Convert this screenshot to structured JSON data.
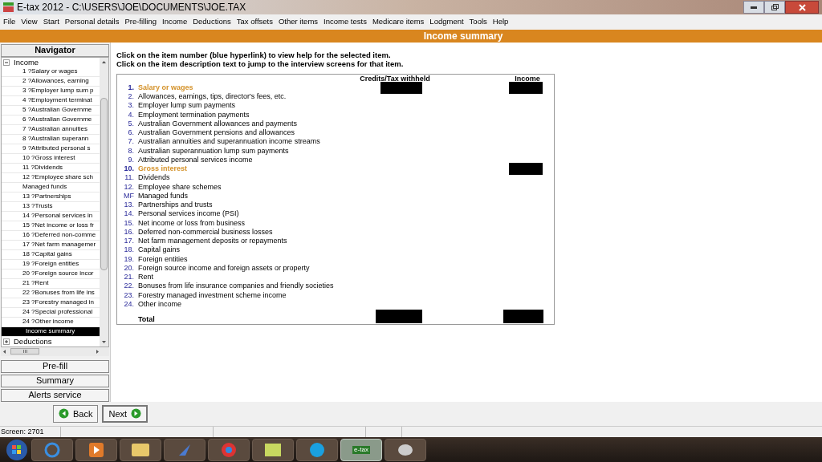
{
  "window": {
    "title": "E-tax 2012 - C:\\USERS\\JOE\\DOCUMENTS\\JOE.TAX"
  },
  "menu": [
    "File",
    "View",
    "Start",
    "Personal details",
    "Pre-filling",
    "Income",
    "Deductions",
    "Tax offsets",
    "Other items",
    "Income tests",
    "Medicare items",
    "Lodgment",
    "Tools",
    "Help"
  ],
  "page_title": "Income summary",
  "navigator": {
    "title": "Navigator",
    "groups": [
      {
        "label": "Income",
        "expanded": true,
        "children": [
          {
            "label": "1 ?Salary or wages",
            "selected": false
          },
          {
            "label": "2 ?Allowances, earning",
            "selected": false
          },
          {
            "label": "3 ?Employer lump sum p",
            "selected": false
          },
          {
            "label": "4 ?Employment terminat",
            "selected": false
          },
          {
            "label": "5 ?Australian Governme",
            "selected": false
          },
          {
            "label": "6 ?Australian Governme",
            "selected": false
          },
          {
            "label": "7 ?Australian annuities",
            "selected": false
          },
          {
            "label": "8 ?Australian superann",
            "selected": false
          },
          {
            "label": "9 ?Attributed personal s",
            "selected": false
          },
          {
            "label": "10 ?Gross interest",
            "selected": false
          },
          {
            "label": "11 ?Dividends",
            "selected": false
          },
          {
            "label": "12 ?Employee share sch",
            "selected": false
          },
          {
            "label": "Managed funds",
            "selected": false
          },
          {
            "label": "13 ?Partnerships",
            "selected": false
          },
          {
            "label": "13 ?Trusts",
            "selected": false
          },
          {
            "label": "14 ?Personal services in",
            "selected": false
          },
          {
            "label": "15 ?Net income or loss fr",
            "selected": false
          },
          {
            "label": "16 ?Deferred non-comme",
            "selected": false
          },
          {
            "label": "17 ?Net farm managemer",
            "selected": false
          },
          {
            "label": "18 ?Capital gains",
            "selected": false
          },
          {
            "label": "19 ?Foreign entities",
            "selected": false
          },
          {
            "label": "20 ?Foreign source incor",
            "selected": false
          },
          {
            "label": "21 ?Rent",
            "selected": false
          },
          {
            "label": "22 ?Bonuses from life ins",
            "selected": false
          },
          {
            "label": "23 ?Forestry managed in",
            "selected": false
          },
          {
            "label": "24 ?Special professional",
            "selected": false
          },
          {
            "label": "24 ?Other income",
            "selected": false
          },
          {
            "label": "Income summary",
            "selected": true
          }
        ]
      },
      {
        "label": "Deductions",
        "expanded": false
      }
    ]
  },
  "side_buttons": [
    "Pre-fill",
    "Summary",
    "Alerts service"
  ],
  "instructions": [
    "Click on the item number (blue hyperlink) to view help for the selected item.",
    "Click on the item description text to jump to the interview screens for that item."
  ],
  "summary": {
    "columns": [
      "Credits/Tax withheld",
      "Income"
    ],
    "rows": [
      {
        "number": "1.",
        "label": "Salary or wages",
        "has_value": true,
        "credits_redacted": true,
        "income_redacted": true
      },
      {
        "number": "2.",
        "label": "Allowances, earnings, tips, director's fees, etc.",
        "has_value": false,
        "credits_redacted": false,
        "income_redacted": false
      },
      {
        "number": "3.",
        "label": "Employer lump sum payments",
        "has_value": false,
        "credits_redacted": false,
        "income_redacted": false
      },
      {
        "number": "4.",
        "label": "Employment termination payments",
        "has_value": false,
        "credits_redacted": false,
        "income_redacted": false
      },
      {
        "number": "5.",
        "label": "Australian Government allowances and payments",
        "has_value": false,
        "credits_redacted": false,
        "income_redacted": false
      },
      {
        "number": "6.",
        "label": "Australian Government pensions and allowances",
        "has_value": false,
        "credits_redacted": false,
        "income_redacted": false
      },
      {
        "number": "7.",
        "label": "Australian annuities and superannuation income streams",
        "has_value": false,
        "credits_redacted": false,
        "income_redacted": false
      },
      {
        "number": "8.",
        "label": "Australian superannuation lump sum payments",
        "has_value": false,
        "credits_redacted": false,
        "income_redacted": false
      },
      {
        "number": "9.",
        "label": "Attributed personal services income",
        "has_value": false,
        "credits_redacted": false,
        "income_redacted": false
      },
      {
        "number": "10.",
        "label": "Gross interest",
        "has_value": true,
        "credits_redacted": false,
        "income_redacted": true
      },
      {
        "number": "11.",
        "label": "Dividends",
        "has_value": false,
        "credits_redacted": false,
        "income_redacted": false
      },
      {
        "number": "12.",
        "label": "Employee share schemes",
        "has_value": false,
        "credits_redacted": false,
        "income_redacted": false
      },
      {
        "number": "MF",
        "label": "Managed funds",
        "has_value": false,
        "credits_redacted": false,
        "income_redacted": false
      },
      {
        "number": "13.",
        "label": "Partnerships and trusts",
        "has_value": false,
        "credits_redacted": false,
        "income_redacted": false
      },
      {
        "number": "14.",
        "label": "Personal services income (PSI)",
        "has_value": false,
        "credits_redacted": false,
        "income_redacted": false
      },
      {
        "number": "15.",
        "label": "Net income or loss from business",
        "has_value": false,
        "credits_redacted": false,
        "income_redacted": false
      },
      {
        "number": "16.",
        "label": "Deferred non-commercial business losses",
        "has_value": false,
        "credits_redacted": false,
        "income_redacted": false
      },
      {
        "number": "17.",
        "label": "Net farm management deposits or repayments",
        "has_value": false,
        "credits_redacted": false,
        "income_redacted": false
      },
      {
        "number": "18.",
        "label": "Capital gains",
        "has_value": false,
        "credits_redacted": false,
        "income_redacted": false
      },
      {
        "number": "19.",
        "label": "Foreign entities",
        "has_value": false,
        "credits_redacted": false,
        "income_redacted": false
      },
      {
        "number": "20.",
        "label": "Foreign source income and foreign assets or property",
        "has_value": false,
        "credits_redacted": false,
        "income_redacted": false
      },
      {
        "number": "21.",
        "label": "Rent",
        "has_value": false,
        "credits_redacted": false,
        "income_redacted": false
      },
      {
        "number": "22.",
        "label": "Bonuses from life insurance companies and friendly societies",
        "has_value": false,
        "credits_redacted": false,
        "income_redacted": false
      },
      {
        "number": "23.",
        "label": "Forestry managed investment scheme income",
        "has_value": false,
        "credits_redacted": false,
        "income_redacted": false
      },
      {
        "number": "24.",
        "label": "Other income",
        "has_value": false,
        "credits_redacted": false,
        "income_redacted": false
      }
    ],
    "total": {
      "label": "Total",
      "credits_redacted": true,
      "income_redacted": true
    }
  },
  "nav_buttons": [
    "Back",
    "Next"
  ],
  "status_bar": {
    "screen": "Screen: 2701"
  },
  "taskbar": {
    "active_app_label": "e-tax"
  }
}
